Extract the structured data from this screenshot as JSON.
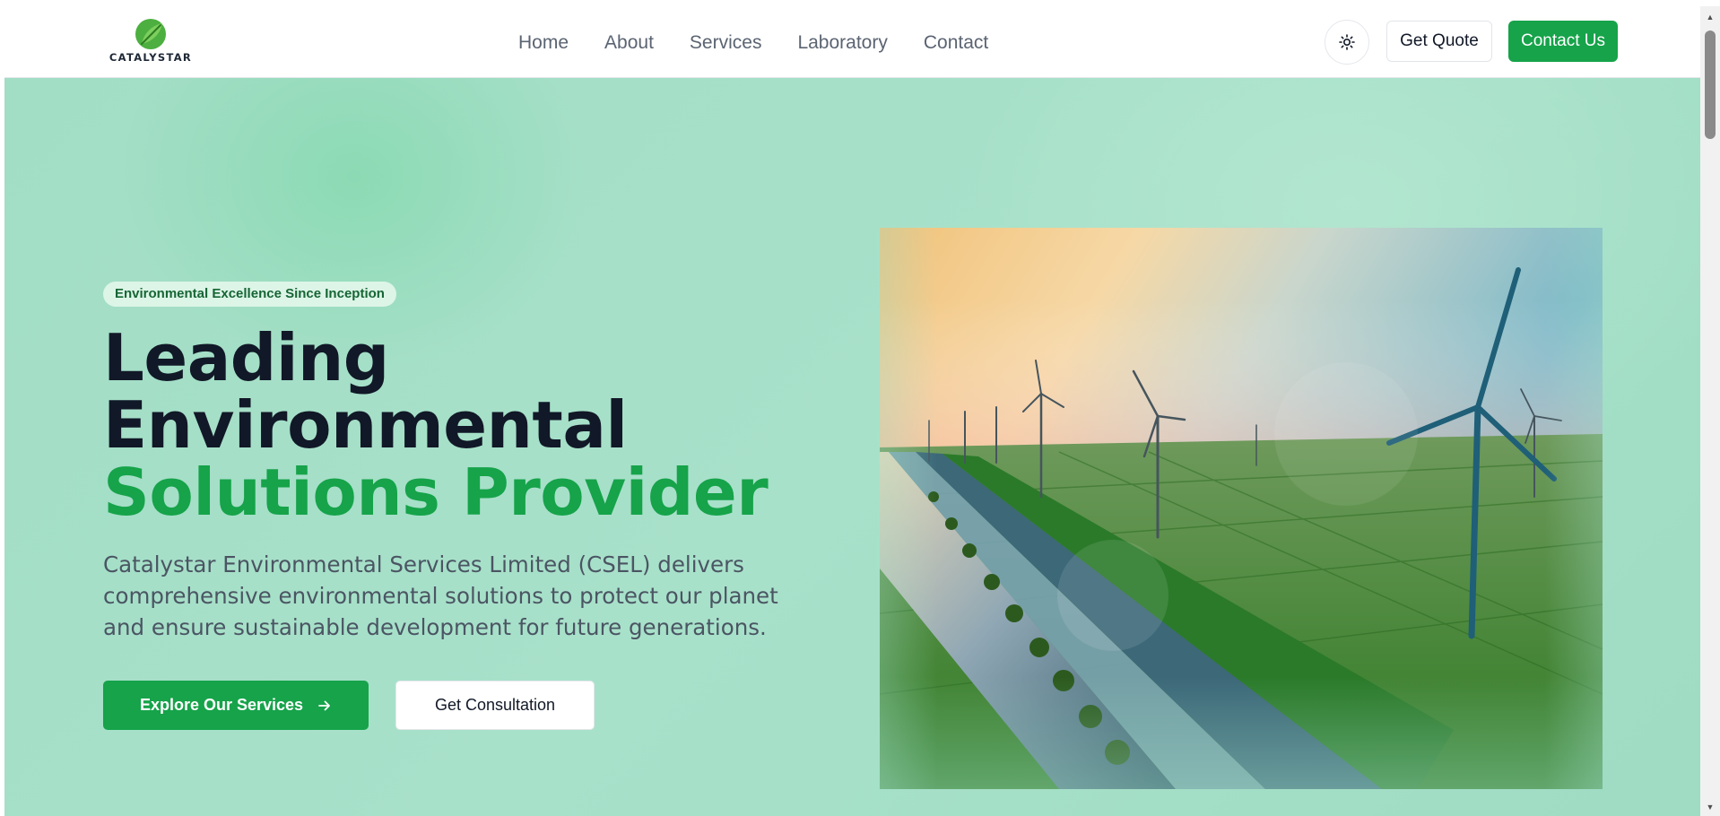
{
  "brand": {
    "name": "CATALYSTAR",
    "colors": {
      "primary": "#16a34a",
      "dark": "#111827",
      "hero_bg": "#a6e0c8"
    }
  },
  "nav": {
    "items": [
      {
        "label": "Home"
      },
      {
        "label": "About"
      },
      {
        "label": "Services"
      },
      {
        "label": "Laboratory"
      },
      {
        "label": "Contact"
      }
    ]
  },
  "header": {
    "theme_icon": "sun-icon",
    "get_quote_label": "Get Quote",
    "contact_label": "Contact Us"
  },
  "hero": {
    "badge": "Environmental Excellence Since Inception",
    "headline_line1": "Leading",
    "headline_line2": "Environmental",
    "headline_line3": "Solutions Provider",
    "description": "Catalystar Environmental Services Limited (CSEL) delivers comprehensive environmental solutions to protect our planet and ensure sustainable development for future generations.",
    "primary_cta": "Explore Our Services",
    "primary_cta_icon": "arrow-right-icon",
    "secondary_cta": "Get Consultation",
    "image_subject": "wind-turbines-river-landscape"
  }
}
